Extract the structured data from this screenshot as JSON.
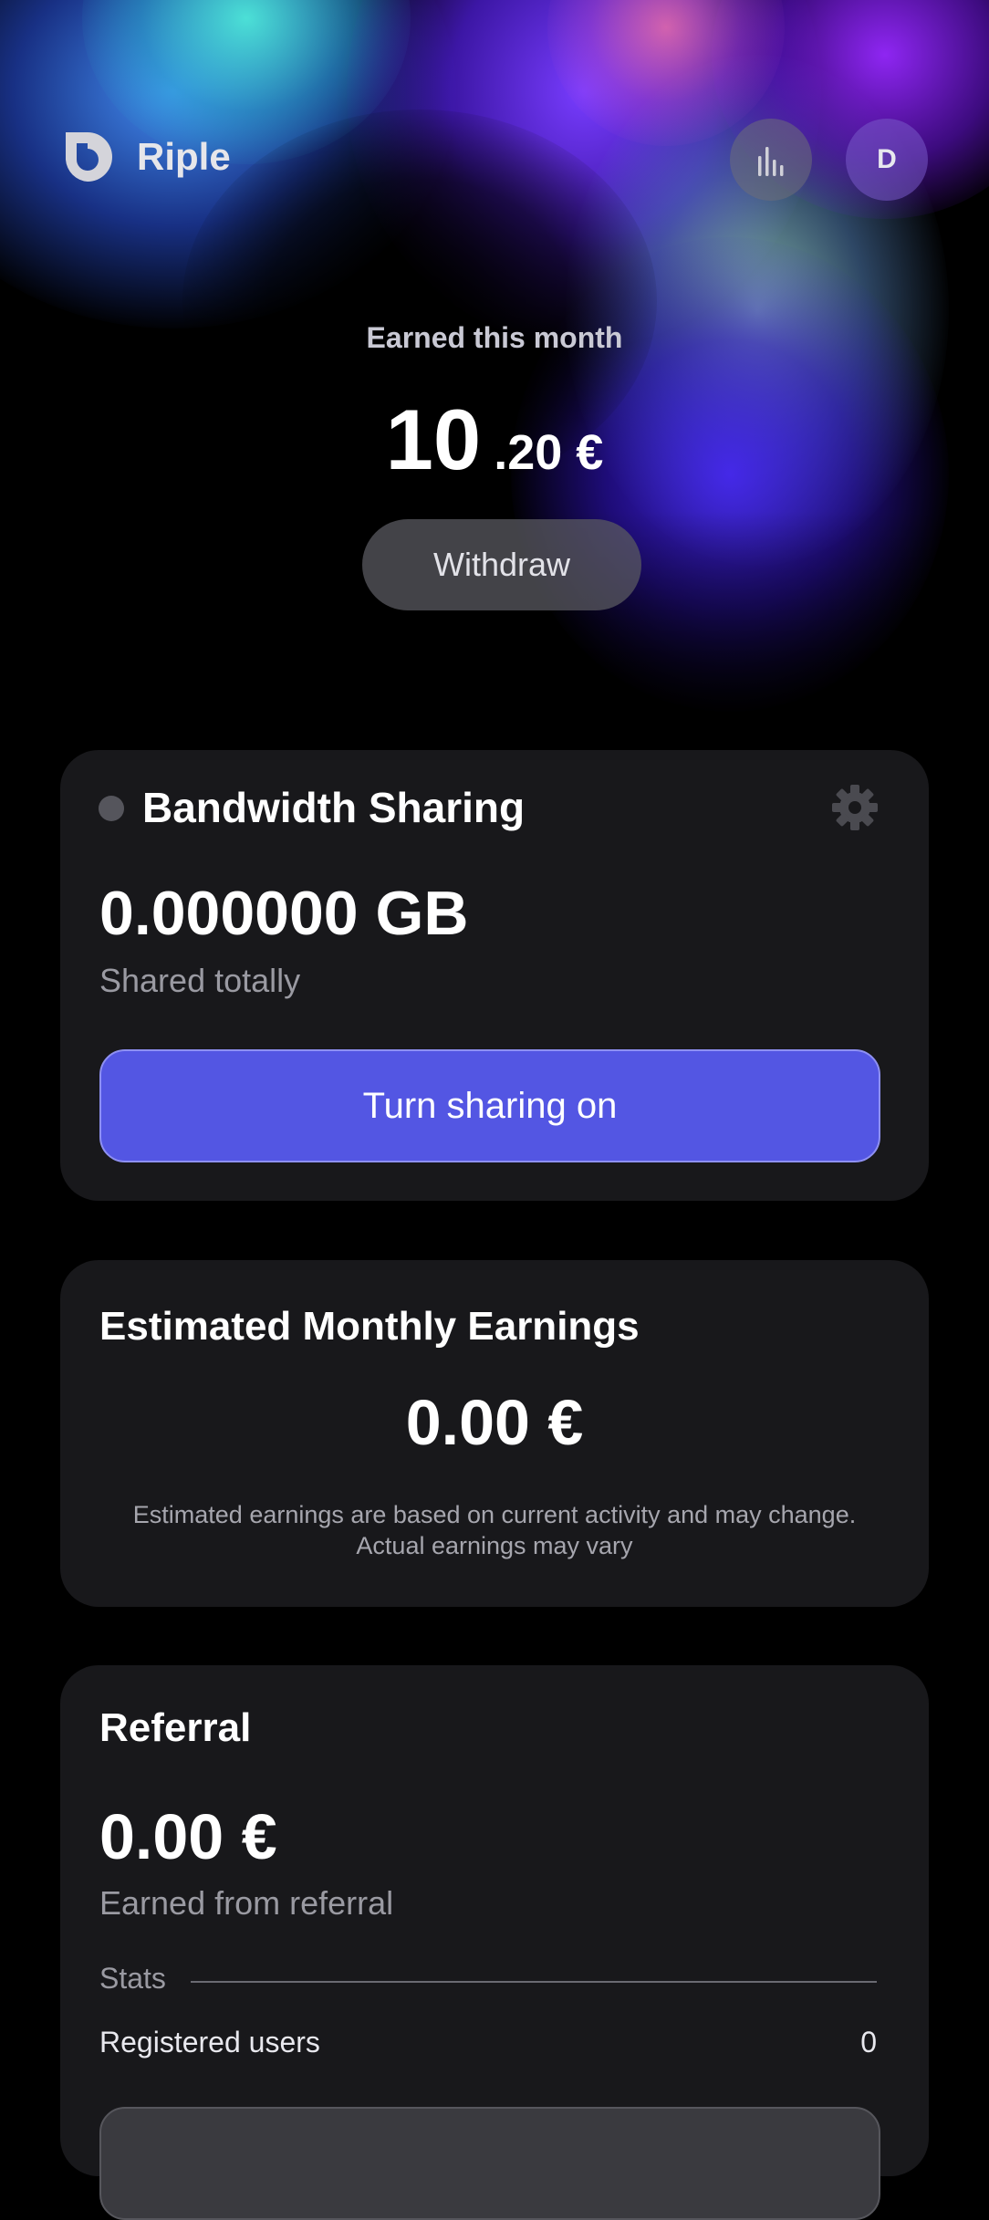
{
  "app": {
    "name": "Riple"
  },
  "header": {
    "stats_icon": "bar-chart-icon",
    "avatar_initial": "D"
  },
  "hero": {
    "label": "Earned this month",
    "amount_int": "10",
    "amount_dec": ".20 €",
    "withdraw_label": "Withdraw"
  },
  "bandwidth": {
    "title": "Bandwidth Sharing",
    "status": "off",
    "settings_icon": "gear-icon",
    "value": "0.000000 GB",
    "subtitle": "Shared totally",
    "button_label": "Turn sharing on"
  },
  "estimate": {
    "title": "Estimated Monthly Earnings",
    "value": "0.00 €",
    "note_line1": "Estimated earnings are based on current activity and may change.",
    "note_line2": "Actual earnings may vary"
  },
  "referral": {
    "title": "Referral",
    "value": "0.00 €",
    "subtitle": "Earned from referral",
    "stats_label": "Stats",
    "registered_label": "Registered users",
    "registered_value": "0"
  },
  "colors": {
    "background": "#000000",
    "card": "#18181b",
    "accent": "#5356e3",
    "muted_text": "#9a9aa2"
  }
}
